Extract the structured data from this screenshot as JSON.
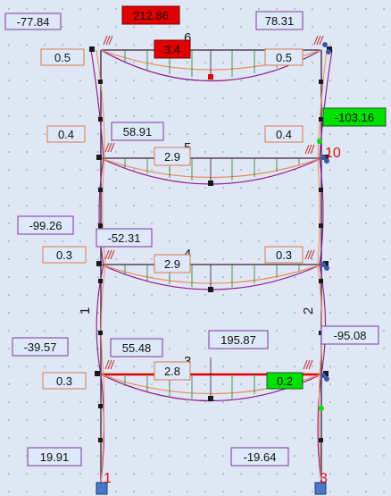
{
  "colors": {
    "background": "#dfe7f4",
    "frame": "#3a1f3a",
    "diagram": "#8b1a8b",
    "deflection": "#e8905a",
    "member_label": "#c02020",
    "node_label": "#e01010",
    "label_fill": "#dde8f8",
    "moment_border": "#7a3a9a",
    "span_border": "#d87a4a",
    "highlight_red": "#e00000",
    "highlight_green": "#00e000",
    "support": "#4a78c8"
  },
  "node_labels": [
    {
      "id": "n1",
      "text": "1"
    },
    {
      "id": "n3",
      "text": "3"
    },
    {
      "id": "n10",
      "text": "10"
    }
  ],
  "member_labels": [
    {
      "id": "m1",
      "text": "1"
    },
    {
      "id": "m2",
      "text": "2"
    },
    {
      "id": "m3",
      "text": "3"
    },
    {
      "id": "m4",
      "text": "4"
    },
    {
      "id": "m5",
      "text": "5"
    },
    {
      "id": "m6",
      "text": "6"
    }
  ],
  "moment_labels": [
    {
      "id": "m_top_left",
      "text": "-77.84",
      "highlight": "none"
    },
    {
      "id": "m_top_mid",
      "text": "212.86",
      "highlight": "red"
    },
    {
      "id": "m_top_right",
      "text": "78.31",
      "highlight": "none"
    },
    {
      "id": "m_f3_mid",
      "text": "58.91",
      "highlight": "none"
    },
    {
      "id": "m_f3_right",
      "text": "-103.16",
      "highlight": "green"
    },
    {
      "id": "m_f2_left",
      "text": "-99.26",
      "highlight": "none"
    },
    {
      "id": "m_f2_mid",
      "text": "-52.31",
      "highlight": "none"
    },
    {
      "id": "m_f1_left",
      "text": "-39.57",
      "highlight": "none"
    },
    {
      "id": "m_f1_mid",
      "text": "55.48",
      "highlight": "none"
    },
    {
      "id": "m_f1_span",
      "text": "195.87",
      "highlight": "none"
    },
    {
      "id": "m_f1_right",
      "text": "-95.08",
      "highlight": "none"
    },
    {
      "id": "m_base_left",
      "text": "19.91",
      "highlight": "none"
    },
    {
      "id": "m_base_right",
      "text": "-19.64",
      "highlight": "none"
    }
  ],
  "span_labels": [
    {
      "id": "s_top_left",
      "text": "0.5",
      "highlight": "none"
    },
    {
      "id": "s_top_mid",
      "text": "3.4",
      "highlight": "red"
    },
    {
      "id": "s_top_right",
      "text": "0.5",
      "highlight": "none"
    },
    {
      "id": "s_f3_left",
      "text": "0.4",
      "highlight": "none"
    },
    {
      "id": "s_f3_mid",
      "text": "2.9",
      "highlight": "none"
    },
    {
      "id": "s_f3_right",
      "text": "0.4",
      "highlight": "none"
    },
    {
      "id": "s_f2_left",
      "text": "0.3",
      "highlight": "none"
    },
    {
      "id": "s_f2_mid",
      "text": "2.9",
      "highlight": "none"
    },
    {
      "id": "s_f2_right",
      "text": "0.3",
      "highlight": "none"
    },
    {
      "id": "s_f1_left",
      "text": "0.3",
      "highlight": "none"
    },
    {
      "id": "s_f1_mid",
      "text": "2.8",
      "highlight": "none"
    },
    {
      "id": "s_f1_right",
      "text": "0.2",
      "highlight": "green"
    }
  ]
}
